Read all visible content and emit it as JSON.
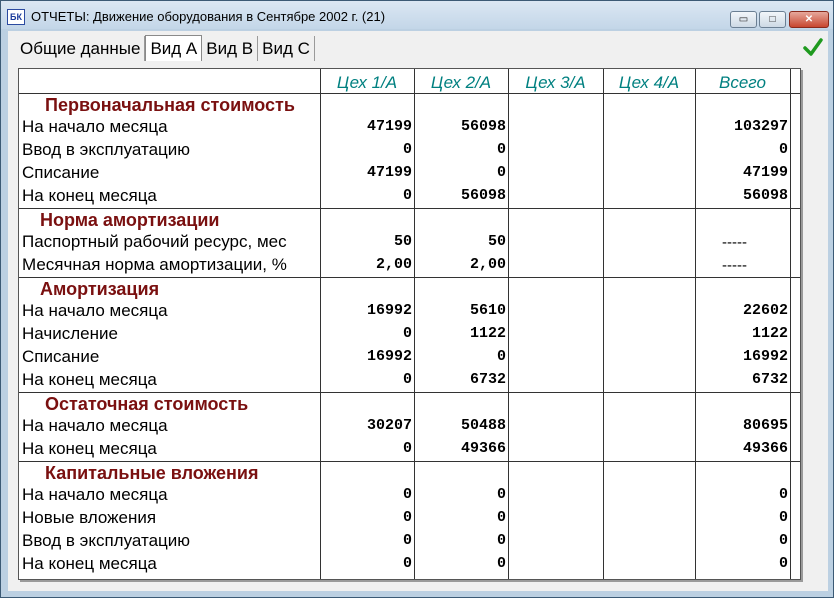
{
  "window": {
    "title": "ОТЧЕТЫ: Движение оборудования в Сентябре 2002 г. (21)",
    "icon_text": "БК",
    "controls": {
      "minimize": "▭",
      "maximize": "□",
      "close": "✕"
    }
  },
  "tabs": [
    {
      "label": "Общие данные",
      "active": false
    },
    {
      "label": "Вид А",
      "active": true
    },
    {
      "label": "Вид В",
      "active": false
    },
    {
      "label": "Вид С",
      "active": false
    }
  ],
  "confirm_icon": "check-icon",
  "table": {
    "columns": [
      "Цех 1/А",
      "Цех 2/А",
      "Цех 3/А",
      "Цех 4/А",
      "Всего"
    ],
    "sections": [
      {
        "title": "Первоначальная стоимость",
        "rows": [
          {
            "label": "На начало месяца",
            "c1": "47199",
            "c2": "56098",
            "c3": "",
            "c4": "",
            "total": "103297"
          },
          {
            "label": "Ввод в эксплуатацию",
            "c1": "0",
            "c2": "0",
            "c3": "",
            "c4": "",
            "total": "0"
          },
          {
            "label": "Списание",
            "c1": "47199",
            "c2": "0",
            "c3": "",
            "c4": "",
            "total": "47199"
          },
          {
            "label": "На конец месяца",
            "c1": "0",
            "c2": "56098",
            "c3": "",
            "c4": "",
            "total": "56098"
          }
        ]
      },
      {
        "title": "Норма амортизации",
        "rows": [
          {
            "label": "Паспортный рабочий ресурс, мес",
            "c1": "50",
            "c2": "50",
            "c3": "",
            "c4": "",
            "total": "-----"
          },
          {
            "label": "Месячная норма амортизации, %",
            "c1": "2,00",
            "c2": "2,00",
            "c3": "",
            "c4": "",
            "total": "-----"
          }
        ]
      },
      {
        "title": "Амортизация",
        "rows": [
          {
            "label": "На начало месяца",
            "c1": "16992",
            "c2": "5610",
            "c3": "",
            "c4": "",
            "total": "22602"
          },
          {
            "label": "Начисление",
            "c1": "0",
            "c2": "1122",
            "c3": "",
            "c4": "",
            "total": "1122"
          },
          {
            "label": "Списание",
            "c1": "16992",
            "c2": "0",
            "c3": "",
            "c4": "",
            "total": "16992"
          },
          {
            "label": "На конец месяца",
            "c1": "0",
            "c2": "6732",
            "c3": "",
            "c4": "",
            "total": "6732"
          }
        ]
      },
      {
        "title": "Остаточная стоимость",
        "rows": [
          {
            "label": "На начало месяца",
            "c1": "30207",
            "c2": "50488",
            "c3": "",
            "c4": "",
            "total": "80695"
          },
          {
            "label": "На конец месяца",
            "c1": "0",
            "c2": "49366",
            "c3": "",
            "c4": "",
            "total": "49366"
          }
        ]
      },
      {
        "title": "Капитальные вложения",
        "rows": [
          {
            "label": "На начало месяца",
            "c1": "0",
            "c2": "0",
            "c3": "",
            "c4": "",
            "total": "0"
          },
          {
            "label": "Новые вложения",
            "c1": "0",
            "c2": "0",
            "c3": "",
            "c4": "",
            "total": "0"
          },
          {
            "label": "Ввод в эксплуатацию",
            "c1": "0",
            "c2": "0",
            "c3": "",
            "c4": "",
            "total": "0"
          },
          {
            "label": "На конец месяца",
            "c1": "0",
            "c2": "0",
            "c3": "",
            "c4": "",
            "total": "0"
          }
        ]
      }
    ]
  }
}
